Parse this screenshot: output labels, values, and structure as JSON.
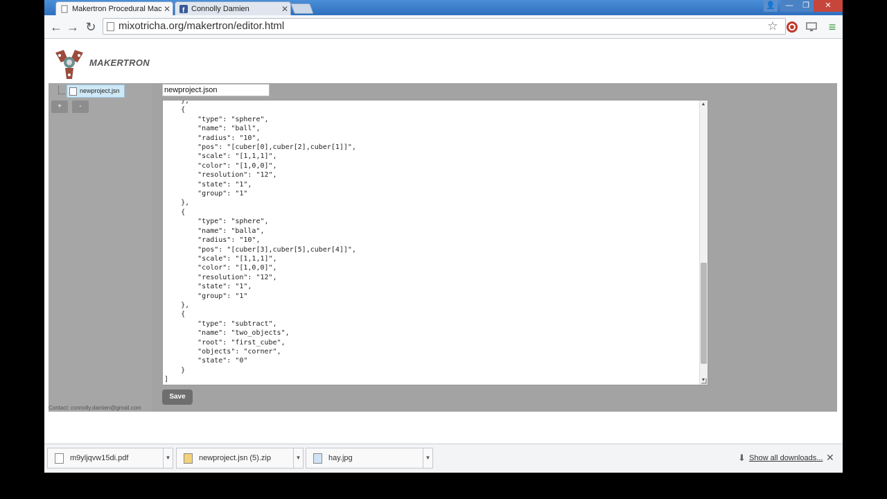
{
  "browser": {
    "tabs": [
      {
        "title": "Makertron Procedural Machi",
        "active": true
      },
      {
        "title": "Connolly Damien",
        "active": false
      }
    ],
    "url": "mixotricha.org/makertron/editor.html",
    "window_controls": {
      "user": "👤",
      "minimize": "—",
      "restore": "❐",
      "close": "✕"
    }
  },
  "icons": {
    "back": "arrow-left-icon",
    "forward": "arrow-right-icon",
    "reload": "reload-icon",
    "star": "star-icon",
    "menu": "menu-icon"
  },
  "app": {
    "brand": "MAKERTRON",
    "file_tree": {
      "selected_file": "newproject.jsn"
    },
    "buttons": {
      "add": "+",
      "remove": "-",
      "save": "Save"
    },
    "filename": "newproject.json",
    "contact": "Contact: connolly.damien@gmail.com",
    "code_lines": [
      "    },",
      "    {",
      "        \"type\": \"sphere\",",
      "        \"name\": \"ball\",",
      "        \"radius\": \"10\",",
      "        \"pos\": \"[cuber[0],cuber[2],cuber[1]]\",",
      "        \"scale\": \"[1,1,1]\",",
      "        \"color\": \"[1,0,0]\",",
      "        \"resolution\": \"12\",",
      "        \"state\": \"1\",",
      "        \"group\": \"1\"",
      "    },",
      "    {",
      "        \"type\": \"sphere\",",
      "        \"name\": \"balla\",",
      "        \"radius\": \"10\",",
      "        \"pos\": \"[cuber[3],cuber[5],cuber[4]]\",",
      "        \"scale\": \"[1,1,1]\",",
      "        \"color\": \"[1,0,0]\",",
      "        \"resolution\": \"12\",",
      "        \"state\": \"1\",",
      "        \"group\": \"1\"",
      "    },",
      "    {",
      "        \"type\": \"subtract\",",
      "        \"name\": \"two_objects\",",
      "        \"root\": \"first_cube\",",
      "        \"objects\": \"corner\",",
      "        \"state\": \"0\"",
      "    }",
      "]"
    ]
  },
  "downloads": {
    "items": [
      "m9yljqvw15di.pdf",
      "newproject.jsn (5).zip",
      "hay.jpg"
    ],
    "show_all": "Show all downloads...",
    "close": "✕"
  },
  "colors": {
    "tabstrip": "#2f6fbe",
    "editor_bg": "#a3a3a3",
    "save_button": "#6e6e6e",
    "selected_file_bg": "#cfe8f6"
  }
}
